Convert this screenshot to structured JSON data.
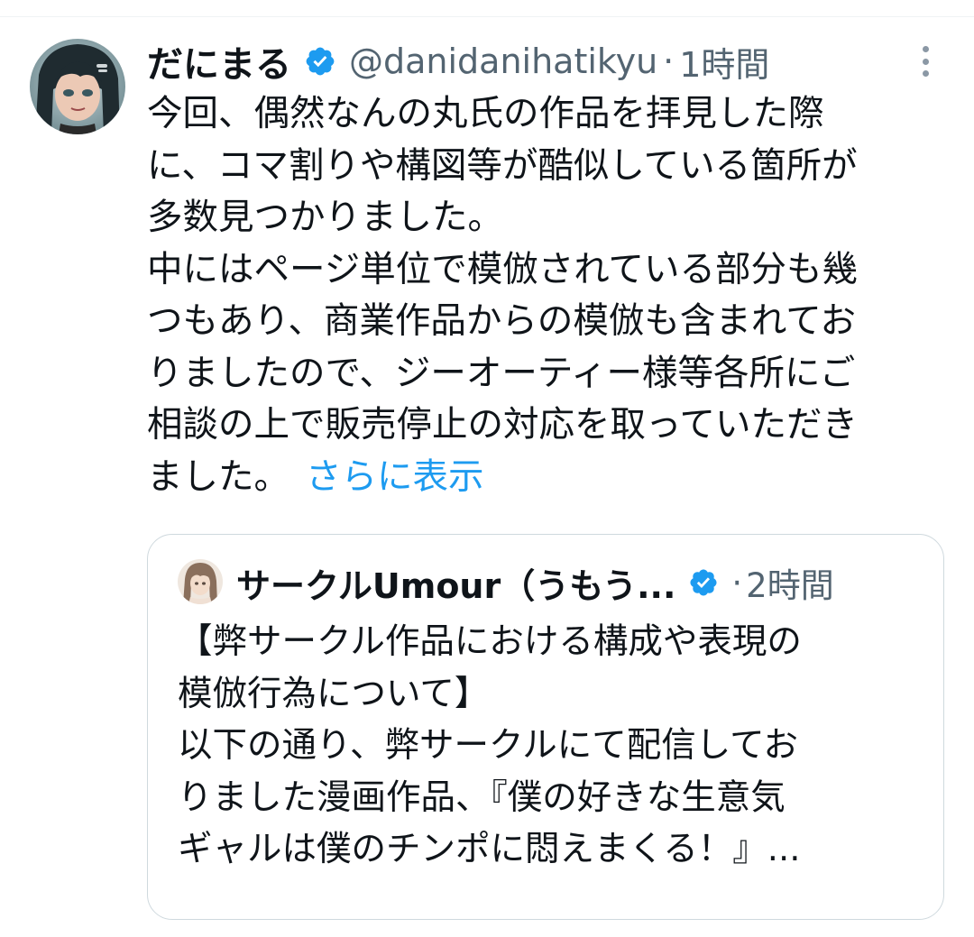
{
  "tweet": {
    "display_name": "だにまる",
    "handle": "@danidanihatikyu",
    "separator": "·",
    "time": "1時間",
    "verified_icon": "verified-badge-icon",
    "more_icon": "more-vertical-icon",
    "text_lines": [
      "今回、偶然なんの丸氏の作品を拝見した際",
      "に、コマ割りや構図等が酷似している箇所が",
      "多数見つかりました。",
      "中にはページ単位で模倣されている部分も幾",
      "つもあり、商業作品からの模倣も含まれてお",
      "りましたので、ジーオーティー様等各所にご",
      "相談の上で販売停止の対応を取っていただき",
      "ました。"
    ],
    "show_more": "さらに表示"
  },
  "quote": {
    "display_name": "サークルUmour（うもう...",
    "separator": "·",
    "time": "2時間",
    "verified_icon": "verified-badge-icon",
    "text_lines": [
      "【弊サークル作品における構成や表現の",
      "模倣行為について】",
      "以下の通り、弊サークルにて配信してお",
      "りました漫画作品、『僕の好きな生意気",
      "ギャルは僕のチンポに悶えまくる！』..."
    ]
  },
  "colors": {
    "text_primary": "#0f1419",
    "text_secondary": "#536471",
    "link": "#1d9bf0",
    "verified": "#1d9bf0",
    "border": "#cfd9de"
  }
}
